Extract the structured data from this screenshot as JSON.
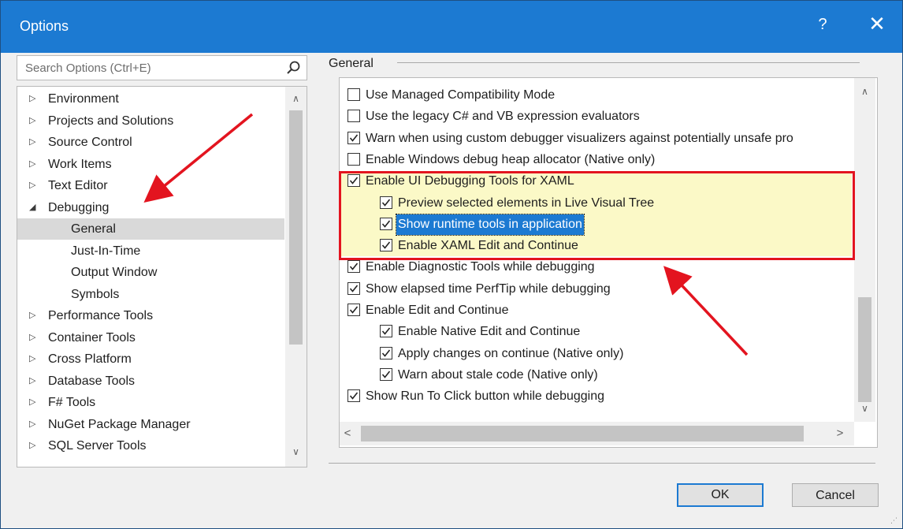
{
  "window": {
    "title": "Options",
    "help_label": "?",
    "close_label": "✕"
  },
  "search": {
    "placeholder": "Search Options (Ctrl+E)",
    "icon": "search-icon"
  },
  "tree": {
    "items": [
      {
        "label": "Environment",
        "arrow": "▷",
        "level": 0
      },
      {
        "label": "Projects and Solutions",
        "arrow": "▷",
        "level": 0
      },
      {
        "label": "Source Control",
        "arrow": "▷",
        "level": 0
      },
      {
        "label": "Work Items",
        "arrow": "▷",
        "level": 0
      },
      {
        "label": "Text Editor",
        "arrow": "▷",
        "level": 0
      },
      {
        "label": "Debugging",
        "arrow": "◢",
        "level": 0
      },
      {
        "label": "General",
        "arrow": "",
        "level": 1,
        "selected": true
      },
      {
        "label": "Just-In-Time",
        "arrow": "",
        "level": 1
      },
      {
        "label": "Output Window",
        "arrow": "",
        "level": 1
      },
      {
        "label": "Symbols",
        "arrow": "",
        "level": 1
      },
      {
        "label": "Performance Tools",
        "arrow": "▷",
        "level": 0
      },
      {
        "label": "Container Tools",
        "arrow": "▷",
        "level": 0
      },
      {
        "label": "Cross Platform",
        "arrow": "▷",
        "level": 0
      },
      {
        "label": "Database Tools",
        "arrow": "▷",
        "level": 0
      },
      {
        "label": "F# Tools",
        "arrow": "▷",
        "level": 0
      },
      {
        "label": "NuGet Package Manager",
        "arrow": "▷",
        "level": 0
      },
      {
        "label": "SQL Server Tools",
        "arrow": "▷",
        "level": 0
      }
    ]
  },
  "group": {
    "label": "General"
  },
  "options": [
    {
      "label": "Use Managed Compatibility Mode",
      "checked": false,
      "level": 0
    },
    {
      "label": "Use the legacy C# and VB expression evaluators",
      "checked": false,
      "level": 0
    },
    {
      "label": "Warn when using custom debugger visualizers against potentially unsafe pro",
      "checked": true,
      "level": 0
    },
    {
      "label": "Enable Windows debug heap allocator (Native only)",
      "checked": false,
      "level": 0
    },
    {
      "label": "Enable UI Debugging Tools for XAML",
      "checked": true,
      "level": 0
    },
    {
      "label": "Preview selected elements in Live Visual Tree",
      "checked": true,
      "level": 1
    },
    {
      "label": "Show runtime tools in application",
      "checked": true,
      "level": 1,
      "selected": true
    },
    {
      "label": "Enable XAML Edit and Continue",
      "checked": true,
      "level": 1
    },
    {
      "label": "Enable Diagnostic Tools while debugging",
      "checked": true,
      "level": 0
    },
    {
      "label": "Show elapsed time PerfTip while debugging",
      "checked": true,
      "level": 0
    },
    {
      "label": "Enable Edit and Continue",
      "checked": true,
      "level": 0
    },
    {
      "label": "Enable Native Edit and Continue",
      "checked": true,
      "level": 1
    },
    {
      "label": "Apply changes on continue (Native only)",
      "checked": true,
      "level": 1
    },
    {
      "label": "Warn about stale code (Native only)",
      "checked": true,
      "level": 1
    },
    {
      "label": "Show Run To Click button while debugging",
      "checked": true,
      "level": 0
    }
  ],
  "buttons": {
    "ok": "OK",
    "cancel": "Cancel"
  },
  "colors": {
    "title_bar": "#1c7ad2",
    "highlight_fill": "#fbf9c7",
    "annotation_red": "#e3141f"
  }
}
